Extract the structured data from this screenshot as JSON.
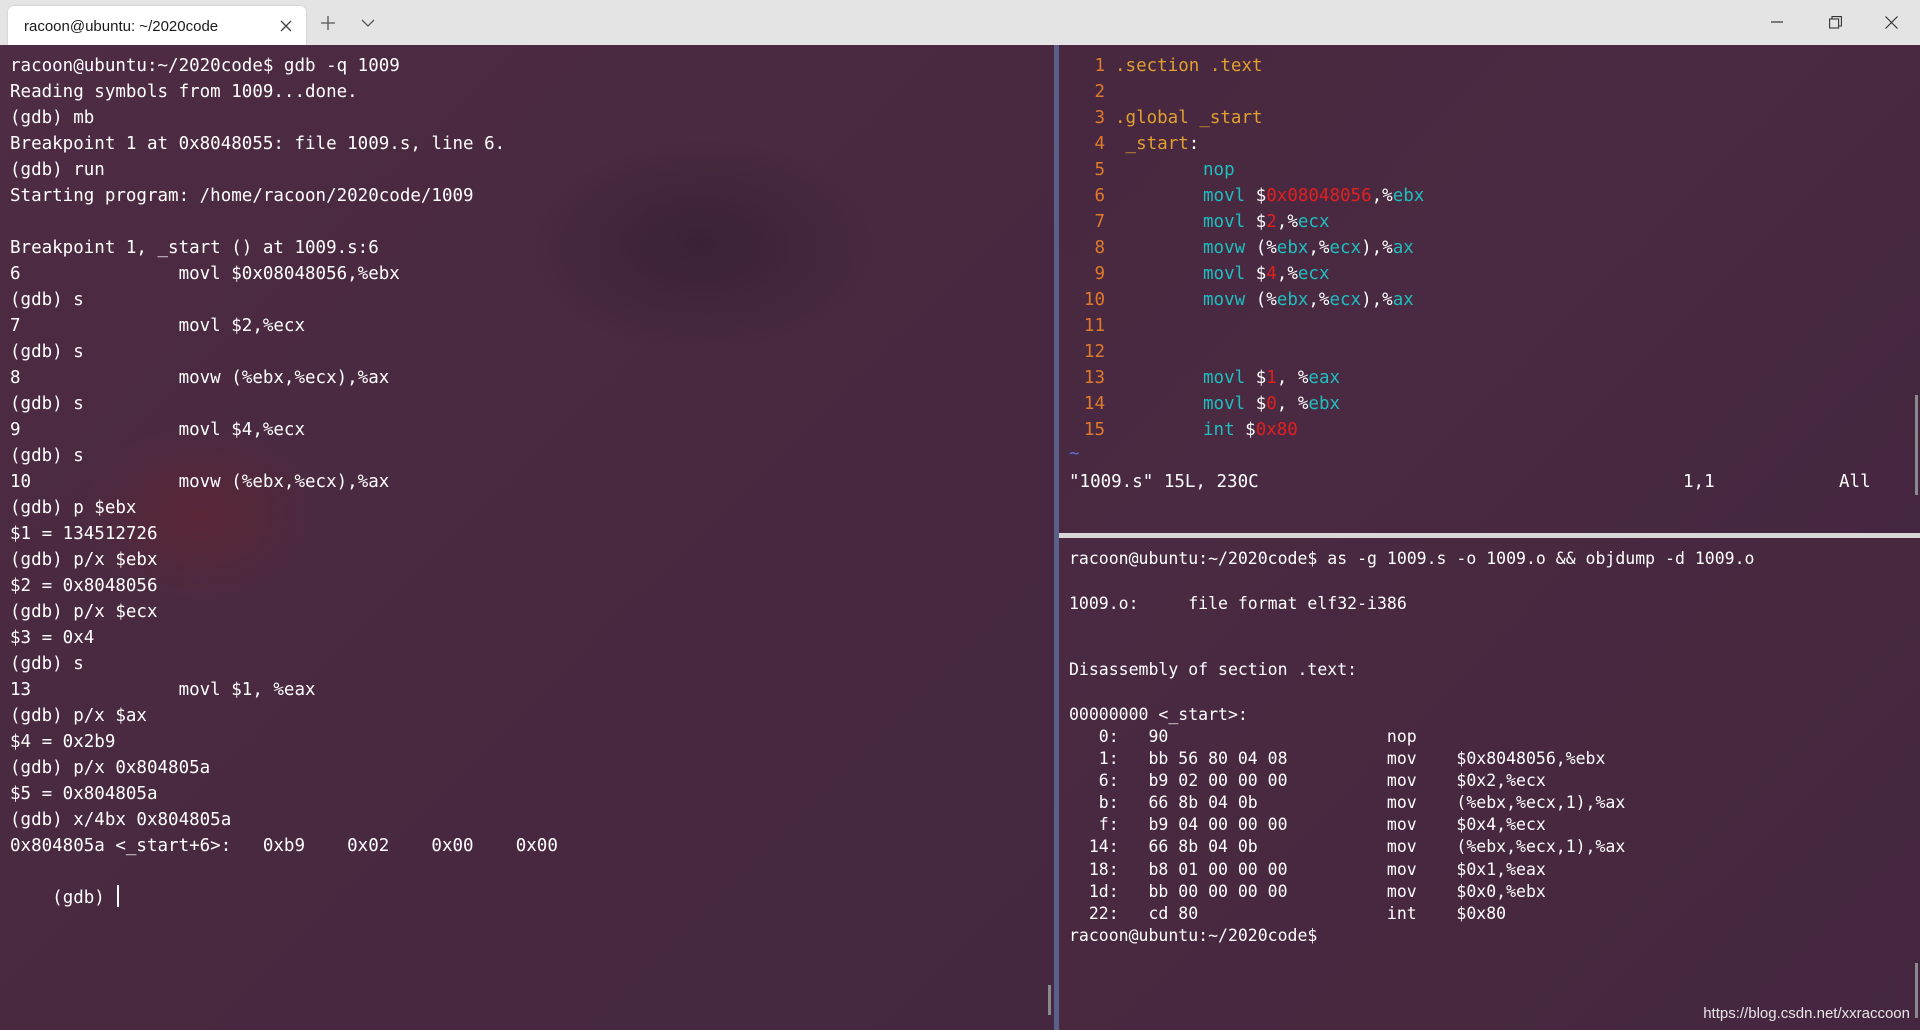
{
  "window": {
    "tab_title": "racoon@ubuntu: ~/2020code"
  },
  "gdb_lines": [
    "racoon@ubuntu:~/2020code$ gdb -q 1009",
    "Reading symbols from 1009...done.",
    "(gdb) mb",
    "Breakpoint 1 at 0x8048055: file 1009.s, line 6.",
    "(gdb) run",
    "Starting program: /home/racoon/2020code/1009",
    "",
    "Breakpoint 1, _start () at 1009.s:6",
    "6               movl $0x08048056,%ebx",
    "(gdb) s",
    "7               movl $2,%ecx",
    "(gdb) s",
    "8               movw (%ebx,%ecx),%ax",
    "(gdb) s",
    "9               movl $4,%ecx",
    "(gdb) s",
    "10              movw (%ebx,%ecx),%ax",
    "(gdb) p $ebx",
    "$1 = 134512726",
    "(gdb) p/x $ebx",
    "$2 = 0x8048056",
    "(gdb) p/x $ecx",
    "$3 = 0x4",
    "(gdb) s",
    "13              movl $1, %eax",
    "(gdb) p/x $ax",
    "$4 = 0x2b9",
    "(gdb) p/x 0x804805a",
    "$5 = 0x804805a",
    "(gdb) x/4bx 0x804805a",
    "0x804805a <_start+6>:   0xb9    0x02    0x00    0x00"
  ],
  "gdb_prompt": "(gdb) ",
  "vim": {
    "line_numbers": [
      "1",
      "2",
      "3",
      "4",
      "5",
      "6",
      "7",
      "8",
      "9",
      "10",
      "11",
      "12",
      "13",
      "14",
      "15"
    ],
    "l1": {
      "kw": ".section",
      "arg": ".text"
    },
    "l3": {
      "kw": ".global",
      "arg": "_start"
    },
    "l4": {
      "label": "_start",
      "colon": ":"
    },
    "l5": {
      "mn": "nop"
    },
    "l6": {
      "mn": "movl",
      "dollar": "$",
      "imm": "0x08048056",
      "comma": ",",
      "pct": "%",
      "reg": "ebx"
    },
    "l7": {
      "mn": "movl",
      "dollar": "$",
      "imm": "2",
      "comma": ",",
      "pct": "%",
      "reg": "ecx"
    },
    "l8": {
      "mn": "movw",
      "open": "(%",
      "r1": "ebx",
      "mid": ",%",
      "r2": "ecx",
      "close": "),%",
      "r3": "ax"
    },
    "l9": {
      "mn": "movl",
      "dollar": "$",
      "imm": "4",
      "comma": ",",
      "pct": "%",
      "reg": "ecx"
    },
    "l10": {
      "mn": "movw",
      "open": "(%",
      "r1": "ebx",
      "mid": ",%",
      "r2": "ecx",
      "close": "),%",
      "r3": "ax"
    },
    "l13": {
      "mn": "movl",
      "dollar": "$",
      "imm": "1",
      "comma": ", ",
      "pct": "%",
      "reg": "eax"
    },
    "l14": {
      "mn": "movl",
      "dollar": "$",
      "imm": "0",
      "comma": ", ",
      "pct": "%",
      "reg": "ebx"
    },
    "l15": {
      "mn": "int",
      "dollar": "$",
      "imm": "0x80"
    },
    "tilde": "~",
    "status_file": "\"1009.s\" 15L, 230C",
    "status_pos": "1,1",
    "status_all": "All"
  },
  "shell_lines": [
    "racoon@ubuntu:~/2020code$ as -g 1009.s -o 1009.o && objdump -d 1009.o",
    "",
    "1009.o:     file format elf32-i386",
    "",
    "",
    "Disassembly of section .text:",
    "",
    "00000000 <_start>:",
    "   0:   90                      nop",
    "   1:   bb 56 80 04 08          mov    $0x8048056,%ebx",
    "   6:   b9 02 00 00 00          mov    $0x2,%ecx",
    "   b:   66 8b 04 0b             mov    (%ebx,%ecx,1),%ax",
    "   f:   b9 04 00 00 00          mov    $0x4,%ecx",
    "  14:   66 8b 04 0b             mov    (%ebx,%ecx,1),%ax",
    "  18:   b8 01 00 00 00          mov    $0x1,%eax",
    "  1d:   bb 00 00 00 00          mov    $0x0,%ebx",
    "  22:   cd 80                   int    $0x80",
    "racoon@ubuntu:~/2020code$"
  ],
  "watermark": "https://blog.csdn.net/xxraccoon",
  "colors": {
    "background": "#4a2a40",
    "line_number": "#e07a2a",
    "directive": "#e0a030",
    "mnemonic": "#1fbfbf",
    "immediate": "#e02020"
  }
}
